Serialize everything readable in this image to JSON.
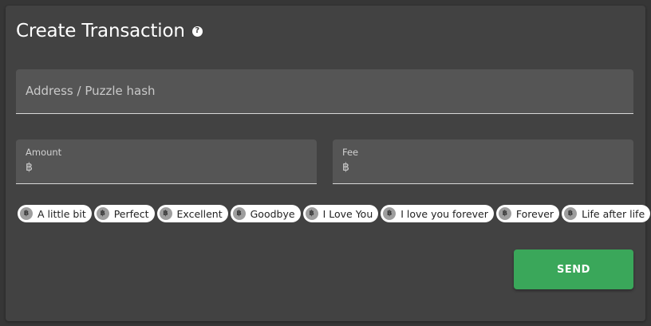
{
  "header": {
    "title": "Create Transaction",
    "help_icon": "?"
  },
  "address": {
    "placeholder": "Address / Puzzle hash"
  },
  "amount": {
    "label": "Amount",
    "currency_symbol": "฿"
  },
  "fee": {
    "label": "Fee",
    "currency_symbol": "฿"
  },
  "chip_icon_symbol": "฿",
  "chips": [
    {
      "label": "A little bit"
    },
    {
      "label": "Perfect"
    },
    {
      "label": "Excellent"
    },
    {
      "label": "Goodbye"
    },
    {
      "label": "I Love You"
    },
    {
      "label": "I love you forever"
    },
    {
      "label": "Forever"
    },
    {
      "label": "Life after life"
    }
  ],
  "send_button": {
    "label": "SEND"
  },
  "colors": {
    "page_bg": "#363636",
    "card_bg": "#424242",
    "field_bg": "#555555",
    "send_green": "#3aa75a"
  }
}
